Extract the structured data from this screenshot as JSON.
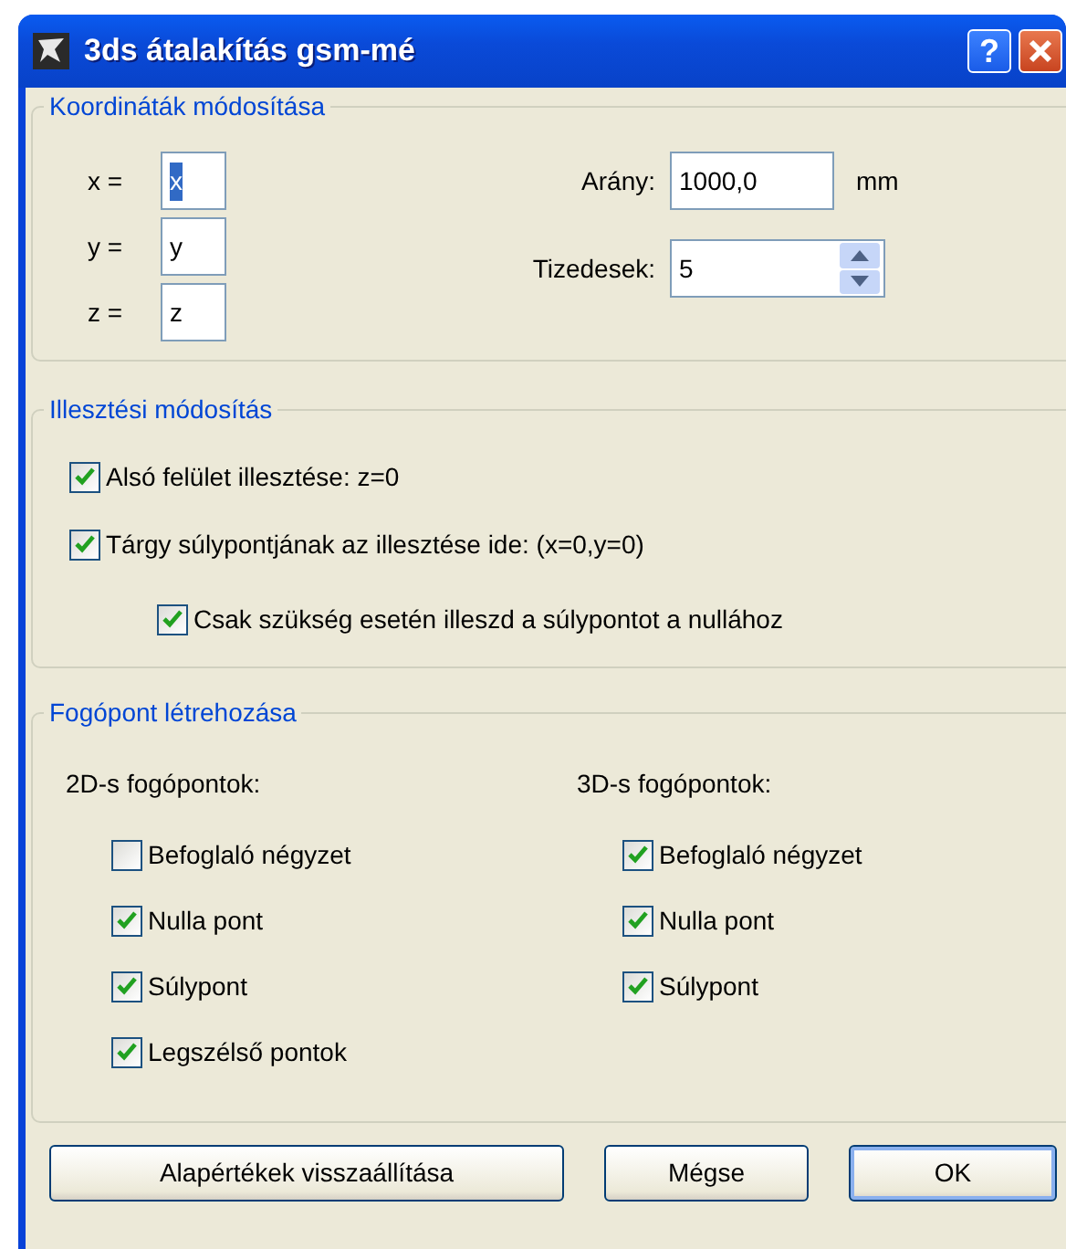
{
  "window": {
    "title": "3ds átalakítás gsm-mé",
    "help": "?"
  },
  "coordinates": {
    "legend": "Koordináták módosítása",
    "axes": [
      {
        "label": "x =",
        "value": "x",
        "text_selected": true
      },
      {
        "label": "y =",
        "value": "y",
        "text_selected": false
      },
      {
        "label": "z =",
        "value": "z",
        "text_selected": false
      }
    ],
    "scale": {
      "label": "Arány:",
      "value": "1000,0",
      "unit": "mm"
    },
    "decimals": {
      "label": "Tizedesek:",
      "value": "5"
    }
  },
  "alignment": {
    "legend": "Illesztési módosítás",
    "options": [
      {
        "label": "Alsó felület illesztése: z=0",
        "checked": true
      },
      {
        "label": "Tárgy súlypontjának az illesztése ide: (x=0,y=0)",
        "checked": true,
        "children": [
          {
            "label": "Csak szükség esetén illeszd a súlypontot a nullához",
            "checked": true
          }
        ]
      }
    ]
  },
  "grip_points": {
    "legend": "Fogópont létrehozása",
    "columns": [
      {
        "heading": "2D-s fogópontok:",
        "options": [
          {
            "label": "Befoglaló négyzet",
            "checked": false
          },
          {
            "label": "Nulla pont",
            "checked": true
          },
          {
            "label": "Súlypont",
            "checked": true
          },
          {
            "label": "Legszélső pontok",
            "checked": true
          }
        ]
      },
      {
        "heading": "3D-s fogópontok:",
        "options": [
          {
            "label": "Befoglaló négyzet",
            "checked": true
          },
          {
            "label": "Nulla pont",
            "checked": true
          },
          {
            "label": "Súlypont",
            "checked": true
          }
        ]
      }
    ]
  },
  "buttons": [
    {
      "label": "Alapértékek visszaállítása",
      "default": false
    },
    {
      "label": "Mégse",
      "default": false
    },
    {
      "label": "OK",
      "default": true
    }
  ]
}
